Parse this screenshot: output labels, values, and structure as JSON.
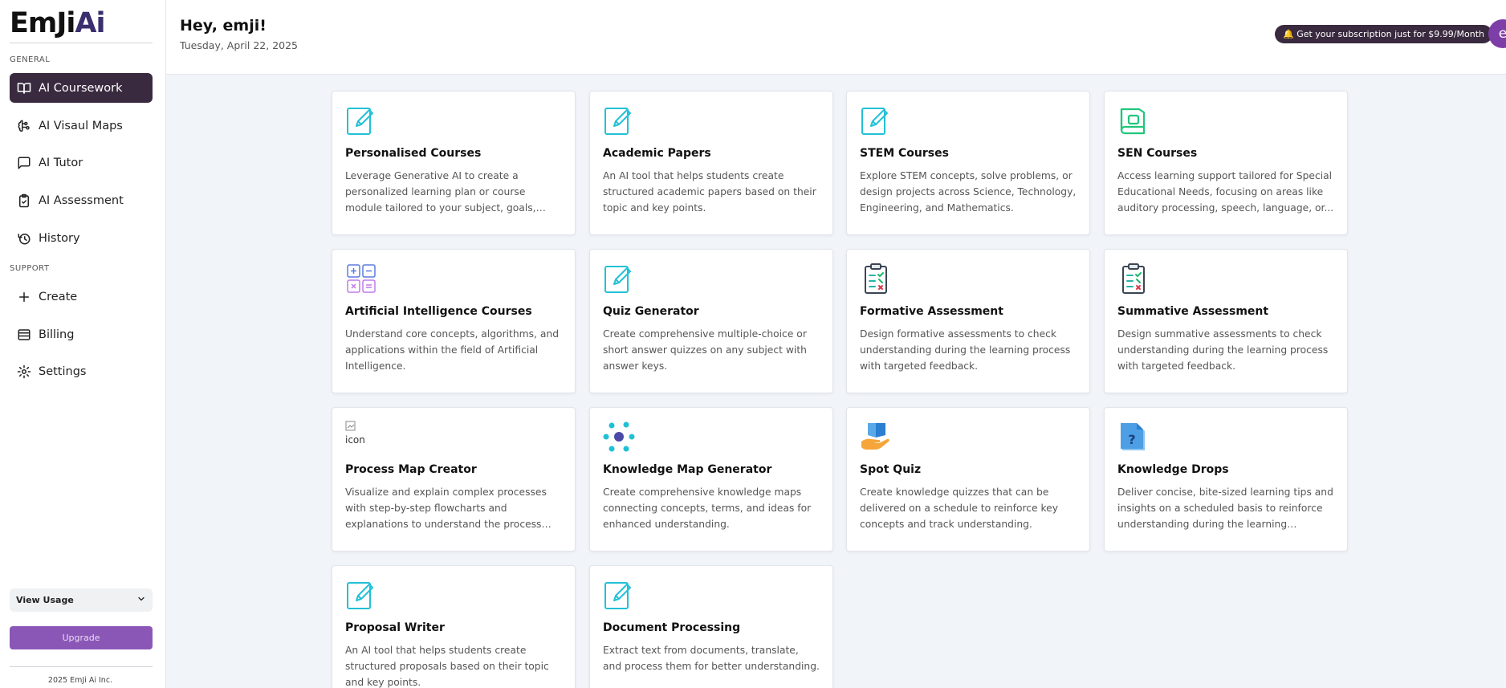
{
  "brand": {
    "logo_main": "EmJi",
    "logo_accent": "Ai"
  },
  "sidebar": {
    "general_label": "GENERAL",
    "support_label": "SUPPORT",
    "general_items": [
      {
        "label": "AI Coursework",
        "icon": "book-icon",
        "active": true
      },
      {
        "label": "AI Visaul Maps",
        "icon": "brain-icon"
      },
      {
        "label": "AI Tutor",
        "icon": "chat-icon"
      },
      {
        "label": "AI Assessment",
        "icon": "clipboard-check-icon"
      },
      {
        "label": "History",
        "icon": "history-icon"
      }
    ],
    "support_items": [
      {
        "label": "Create",
        "icon": "plus-icon"
      },
      {
        "label": "Billing",
        "icon": "billing-icon"
      },
      {
        "label": "Settings",
        "icon": "gear-icon"
      }
    ],
    "view_usage": "View Usage",
    "upgrade": "Upgrade",
    "footer": "2025 EmJi Ai Inc."
  },
  "header": {
    "greeting": "Hey, emji!",
    "date": "Tuesday, April 22, 2025",
    "subscription": "🔔 Get your subscription just for $9.99/Month",
    "avatar_initial": "e"
  },
  "cards": [
    {
      "title": "Personalised Courses",
      "desc": "Leverage Generative AI to create a personalized learning plan or course module tailored to your subject, goals, knowledge...",
      "icon": "pencil-note-icon"
    },
    {
      "title": "Academic Papers",
      "desc": "An AI tool that helps students create structured academic papers based on their topic and key points.",
      "icon": "pencil-note-icon"
    },
    {
      "title": "STEM Courses",
      "desc": "Explore STEM concepts, solve problems, or design projects across Science, Technology, Engineering, and Mathematics.",
      "icon": "pencil-note-icon"
    },
    {
      "title": "SEN Courses",
      "desc": "Access learning support tailored for Special Educational Needs, focusing on areas like auditory processing, speech, language, or...",
      "icon": "green-book-icon"
    },
    {
      "title": "Artificial Intelligence Courses",
      "desc": "Understand core concepts, algorithms, and applications within the field of Artificial Intelligence.",
      "icon": "calculator-grid-icon"
    },
    {
      "title": "Quiz Generator",
      "desc": "Create comprehensive multiple-choice or short answer quizzes on any subject with answer keys.",
      "icon": "pencil-note-icon"
    },
    {
      "title": "Formative Assessment",
      "desc": "Design formative assessments to check understanding during the learning process with targeted feedback.",
      "icon": "clipboard-checklist-icon"
    },
    {
      "title": "Summative Assessment",
      "desc": "Design summative assessments to check understanding during the learning process with targeted feedback.",
      "icon": "clipboard-checklist-icon"
    },
    {
      "title": "Process Map Creator",
      "desc": "Visualize and explain complex processes with step-by-step flowcharts and explanations to understand the process better.",
      "icon": "broken-image-icon",
      "alt": "icon"
    },
    {
      "title": "Knowledge Map Generator",
      "desc": "Create comprehensive knowledge maps connecting concepts, terms, and ideas for enhanced understanding.",
      "icon": "network-icon"
    },
    {
      "title": "Spot Quiz",
      "desc": "Create knowledge quizzes that can be delivered on a schedule to reinforce key concepts and track understanding.",
      "icon": "hand-book-icon"
    },
    {
      "title": "Knowledge Drops",
      "desc": "Deliver concise, bite-sized learning tips and insights on a scheduled basis to reinforce understanding during the learning process,...",
      "icon": "question-doc-icon"
    },
    {
      "title": "Proposal Writer",
      "desc": "An AI tool that helps students create structured proposals based on their topic and key points.",
      "icon": "pencil-note-icon"
    },
    {
      "title": "Document Processing",
      "desc": "Extract text from documents, translate, and process them for better understanding.",
      "icon": "pencil-note-icon"
    }
  ]
}
